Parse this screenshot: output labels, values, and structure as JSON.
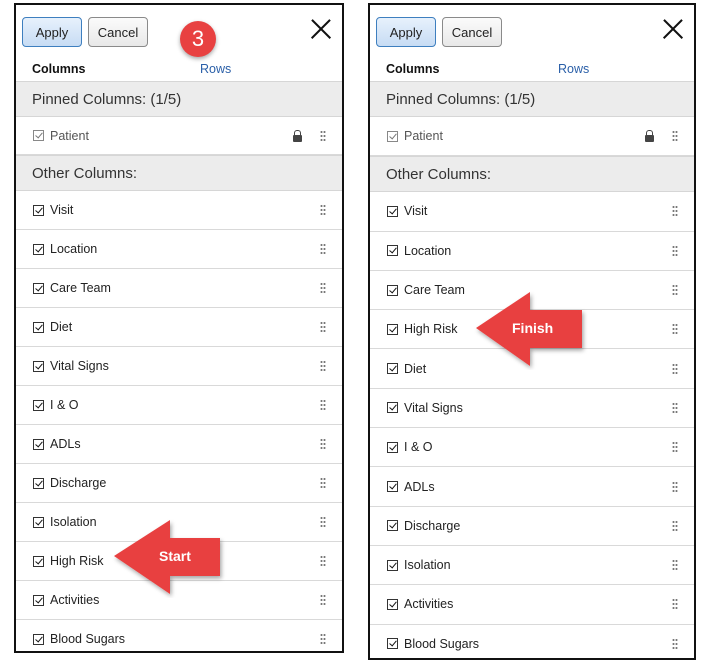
{
  "left_panel": {
    "apply_label": "Apply",
    "cancel_label": "Cancel",
    "tabs": {
      "columns": "Columns",
      "rows": "Rows"
    },
    "pinned_header": "Pinned Columns: (1/5)",
    "pinned": [
      {
        "label": "Patient"
      }
    ],
    "other_header": "Other Columns:",
    "columns": [
      {
        "label": "Visit"
      },
      {
        "label": "Location"
      },
      {
        "label": "Care Team"
      },
      {
        "label": "Diet"
      },
      {
        "label": "Vital Signs"
      },
      {
        "label": "I & O"
      },
      {
        "label": "ADLs"
      },
      {
        "label": "Discharge"
      },
      {
        "label": "Isolation"
      },
      {
        "label": "High Risk"
      },
      {
        "label": "Activities"
      },
      {
        "label": "Blood Sugars"
      }
    ]
  },
  "right_panel": {
    "apply_label": "Apply",
    "cancel_label": "Cancel",
    "tabs": {
      "columns": "Columns",
      "rows": "Rows"
    },
    "pinned_header": "Pinned Columns: (1/5)",
    "pinned": [
      {
        "label": "Patient"
      }
    ],
    "other_header": "Other Columns:",
    "columns": [
      {
        "label": "Visit"
      },
      {
        "label": "Location"
      },
      {
        "label": "Care Team"
      },
      {
        "label": "High Risk"
      },
      {
        "label": "Diet"
      },
      {
        "label": "Vital Signs"
      },
      {
        "label": "I & O"
      },
      {
        "label": "ADLs"
      },
      {
        "label": "Discharge"
      },
      {
        "label": "Isolation"
      },
      {
        "label": "Activities"
      },
      {
        "label": "Blood Sugars"
      }
    ]
  },
  "annotations": {
    "step_number": "3",
    "start_label": "Start",
    "finish_label": "Finish",
    "arrow_color": "#e84141"
  },
  "icons": {
    "close": "close-icon",
    "lock": "lock-icon",
    "drag": "drag-handle-icon",
    "checkbox": "checkbox-checked-icon"
  }
}
